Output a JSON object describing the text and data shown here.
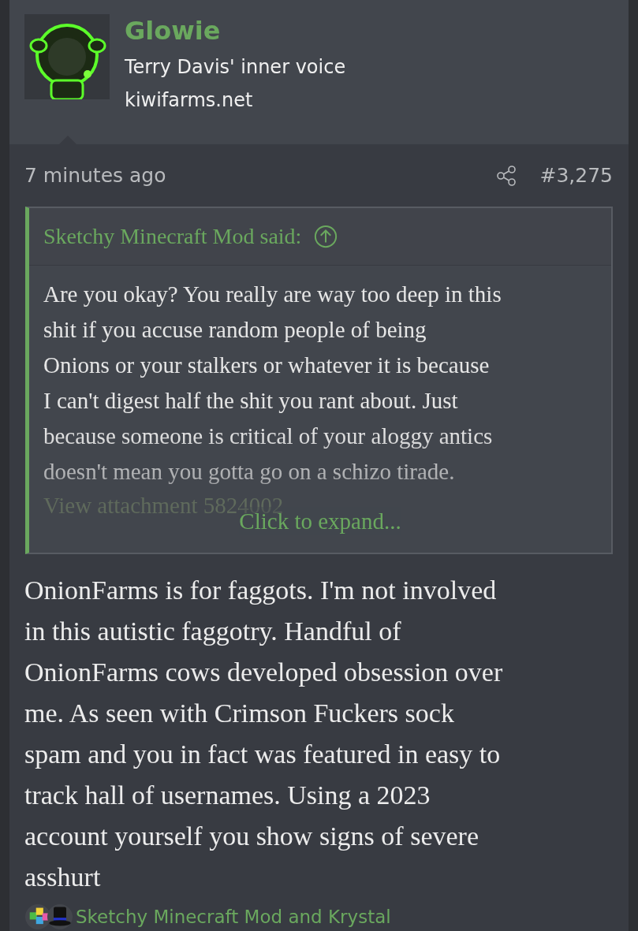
{
  "author": {
    "name": "Glowie",
    "title": "Terry Davis' inner voice",
    "site": "kiwifarms.net"
  },
  "meta": {
    "time": "7 minutes ago",
    "number": "#3,275"
  },
  "quote": {
    "attribution": "Sketchy Minecraft Mod said:",
    "text": "Are you okay? You really are way too deep in this\nshit if you accuse random people of being\nOnions or your stalkers or whatever it is because\nI can't digest half the shit you rant about. Just\nbecause someone is critical of your aloggy antics\ndoesn't mean you gotta go on a schizo tirade.",
    "attachment": "View attachment 5824002",
    "expand": "Click to expand..."
  },
  "body": "OnionFarms is for faggots. I'm not involved\nin this autistic faggotry. Handful of\nOnionFarms cows developed obsession over\nme. As seen with Crimson Fuckers sock\nspam and you in fact was featured in easy to\ntrack hall of usernames. Using a 2023\naccount yourself you show signs of severe\nasshurt",
  "reactions": {
    "icons": [
      {
        "kind": "puzzle"
      },
      {
        "kind": "tophat"
      }
    ],
    "text": "Sketchy Minecraft Mod and Krystal"
  }
}
